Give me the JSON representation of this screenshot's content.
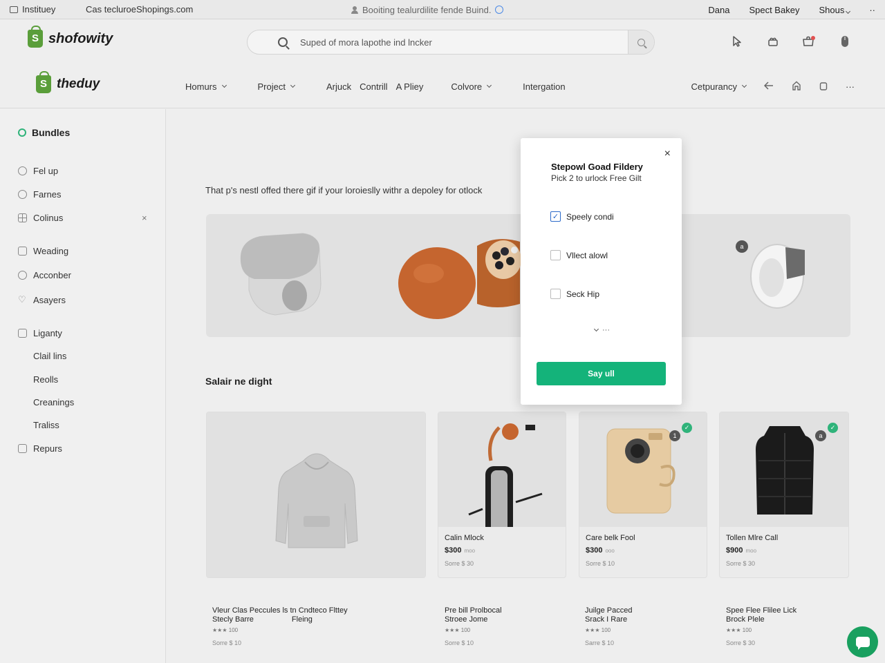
{
  "topbar": {
    "app_name": "Instituey",
    "url": "Cas tecluroeShopings.com",
    "center_text": "Booiting tealurdilite fende Buind.",
    "right_items": [
      "Dana",
      "Spect Bakey",
      "Shous"
    ],
    "more": "··"
  },
  "header": {
    "logo_primary": "shofowity",
    "logo_secondary": "theduy",
    "search_placeholder": "Suped of mora lapothe ind lncker",
    "nav": [
      {
        "label": "Homurs",
        "dropdown": true
      },
      {
        "label": "Project",
        "dropdown": true
      },
      {
        "label": "Arjuck",
        "dropdown": false
      },
      {
        "label": "Contrill",
        "dropdown": false
      },
      {
        "label": "A Pliey",
        "dropdown": false
      },
      {
        "label": "Colvore",
        "dropdown": true
      },
      {
        "label": "Intergation",
        "dropdown": false
      }
    ],
    "currency": "Cetpurancy",
    "more": "···"
  },
  "sidebar": {
    "title": "Bundles",
    "items": [
      {
        "label": "Fel up",
        "icon": "person-icon"
      },
      {
        "label": "Farnes",
        "icon": "clock-icon"
      },
      {
        "label": "Colinus",
        "icon": "grid-icon"
      },
      {
        "label": "Weading",
        "icon": "layers-icon"
      },
      {
        "label": "Acconber",
        "icon": "globe-icon"
      },
      {
        "label": "Asayers",
        "icon": "heart-icon"
      },
      {
        "label": "Liganty",
        "icon": "clipboard-icon"
      },
      {
        "label": "Clail lins",
        "icon": ""
      },
      {
        "label": "Reolls",
        "icon": ""
      },
      {
        "label": "Creanings",
        "icon": ""
      },
      {
        "label": "Traliss",
        "icon": ""
      },
      {
        "label": "Repurs",
        "icon": "list-icon"
      }
    ],
    "close_glyph": "×"
  },
  "main": {
    "intro": "That p's nestl offed there gif if your loroieslly withr a depoley for otlock",
    "section_title": "Salair ne dight",
    "banner_badge": "a",
    "cards": [
      {
        "title": "",
        "price": "",
        "price_note": "",
        "meta": "",
        "badge": "",
        "check": false
      },
      {
        "title": "Calin Mlock",
        "price": "$300",
        "price_note": "moo",
        "meta": "Sorre $ 30",
        "badge": "",
        "check": false
      },
      {
        "title": "Care belk Fool",
        "price": "$300",
        "price_note": "ooo",
        "meta": "Sorre $ 10",
        "badge": "1",
        "check": true
      },
      {
        "title": "Tollen Mlre Call",
        "price": "$900",
        "price_note": "moo",
        "meta": "Sorre $ 30",
        "badge": "a",
        "check": true
      }
    ],
    "below": [
      {
        "line1": "Vleur Clas Peccules ls tn Cndteco Flttey",
        "line2": "Stecly Barre                  Fleing",
        "stars": "★★★ 100",
        "meta": "Sorre $ 10"
      },
      {
        "line1": "Pre bill Prolbocal",
        "line2": "Stroee Jome",
        "stars": "★★★ 100",
        "meta": "Sorre $ 10"
      },
      {
        "line1": "Juilge Pacced",
        "line2": "Srack I Rare",
        "stars": "★★★ 100",
        "meta": "Sarre $ 10"
      },
      {
        "line1": "Spee Flee Flilee Lick",
        "line2": "Brock Plele",
        "stars": "★★★ 100",
        "meta": "Sorre $ 30"
      }
    ]
  },
  "modal": {
    "title": "Stepowl Goad Fildery",
    "subtitle": "Pick 2 to urlock Free Gilt",
    "options": [
      {
        "label": "Speely condi",
        "checked": true
      },
      {
        "label": "Vllect alowl",
        "checked": false
      },
      {
        "label": "Seck Hip",
        "checked": false
      }
    ],
    "more": "···",
    "cta": "Say ull",
    "close": "×"
  },
  "colors": {
    "accent": "#14b37a",
    "check_blue": "#2c6ac9",
    "brand_green": "#5a9e3a"
  }
}
